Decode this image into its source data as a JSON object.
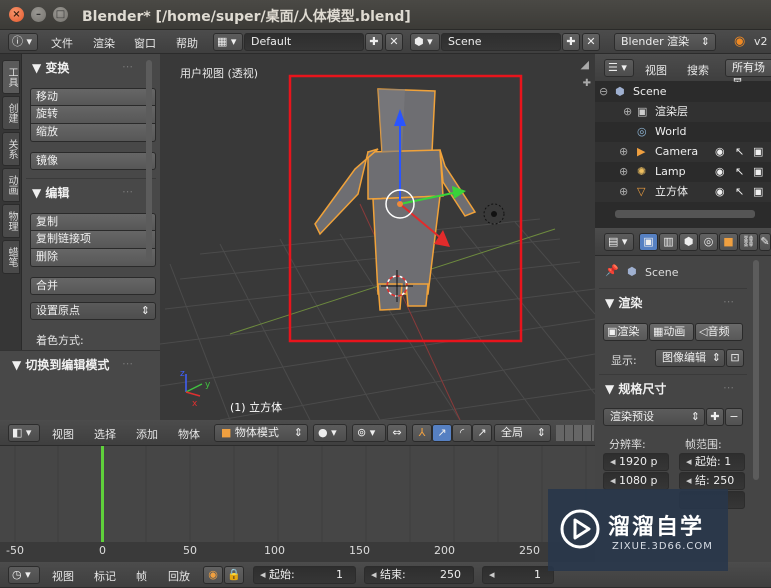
{
  "window": {
    "title": "Blender* [/home/super/桌面/人体模型.blend]",
    "close": "×",
    "minimize": "–",
    "maximize": "□"
  },
  "info_header": {
    "editor_type": "ⓘ",
    "menus": [
      "文件",
      "渲染",
      "窗口",
      "帮助"
    ],
    "layout_value": "Default",
    "scene_value": "Scene",
    "engine_value": "Blender 渲染",
    "version": "v2"
  },
  "tool_tabs": [
    "工具",
    "创建",
    "关系",
    "动画",
    "物理",
    "蜡笔"
  ],
  "toolshelf": {
    "transform_header": "变换",
    "move": "移动",
    "rotate": "旋转",
    "scale": "缩放",
    "mirror": "镜像",
    "edit_header": "编辑",
    "duplicate": "复制",
    "duplicate_linked": "复制链接项",
    "delete": "删除",
    "join": "合并",
    "set_origin": "设置原点",
    "shading_label": "着色方式:",
    "toggle_edit_header": "切换到编辑模式"
  },
  "viewport": {
    "label": "用户视图 (透视)",
    "object_label": "(1) 立方体",
    "highlight_color": "#e8141c"
  },
  "v3d_header": {
    "menus": [
      "视图",
      "选择",
      "添加",
      "物体"
    ],
    "mode": "物体模式",
    "pivot": "全局"
  },
  "timeline": {
    "ruler": [
      "-50",
      "0",
      "50",
      "100",
      "150",
      "200",
      "250"
    ],
    "current_frame_color": "#5fd13b"
  },
  "tl_header": {
    "menus": [
      "视图",
      "标记",
      "帧",
      "回放"
    ],
    "start_label": "起始:",
    "start_value": "1",
    "end_label": "结束:",
    "end_value": "250",
    "current_value": "1"
  },
  "outliner": {
    "view_menu": "视图",
    "search_menu": "搜索",
    "filter": "所有场景",
    "rows": [
      {
        "name": "Scene",
        "icon": "scene-icon"
      },
      {
        "name": "渲染层",
        "icon": "render-layer-icon"
      },
      {
        "name": "World",
        "icon": "world-icon"
      },
      {
        "name": "Camera",
        "icon": "camera-icon"
      },
      {
        "name": "Lamp",
        "icon": "lamp-icon"
      },
      {
        "name": "立方体",
        "icon": "mesh-icon"
      }
    ]
  },
  "properties": {
    "scene_name": "Scene",
    "render_header": "渲染",
    "render_btn": "渲染",
    "anim_btn": "动画",
    "audio_btn": "音频",
    "display_label": "显示:",
    "display_value": "图像编辑",
    "dimensions_header": "规格尺寸",
    "presets": "渲染预设",
    "resolution_label": "分辨率:",
    "frame_range_label": "帧范围:",
    "res_x": "1920 p",
    "res_y": "1080 p",
    "frame_start": "起始: 1",
    "frame_end": "结: 250"
  },
  "watermark": {
    "text": "溜溜自学",
    "url": "ZIXUE.3D66.COM"
  }
}
